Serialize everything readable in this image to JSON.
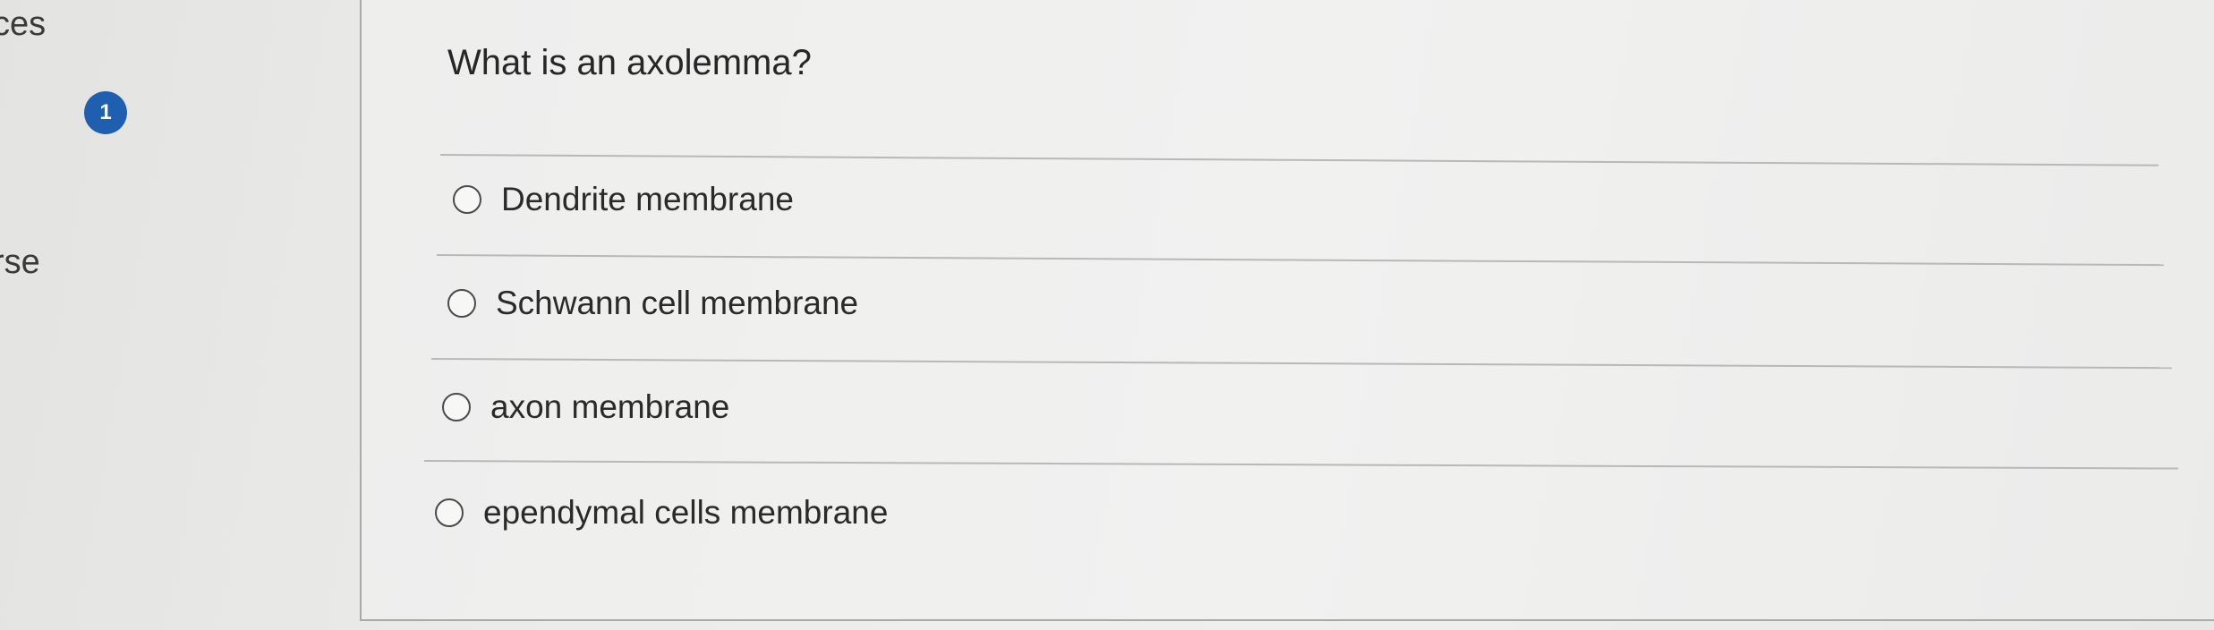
{
  "sidebar": {
    "fragment_top": "ces",
    "fragment_mid": "rse",
    "question_number": "1"
  },
  "question": {
    "text": "What is an axolemma?",
    "options": [
      {
        "label": "Dendrite membrane"
      },
      {
        "label": "Schwann cell membrane"
      },
      {
        "label": "axon membrane"
      },
      {
        "label": "ependymal cells membrane"
      }
    ]
  },
  "colors": {
    "badge": "#1f5fb0",
    "background": "#ececeb",
    "divider": "#b8b8b6"
  }
}
